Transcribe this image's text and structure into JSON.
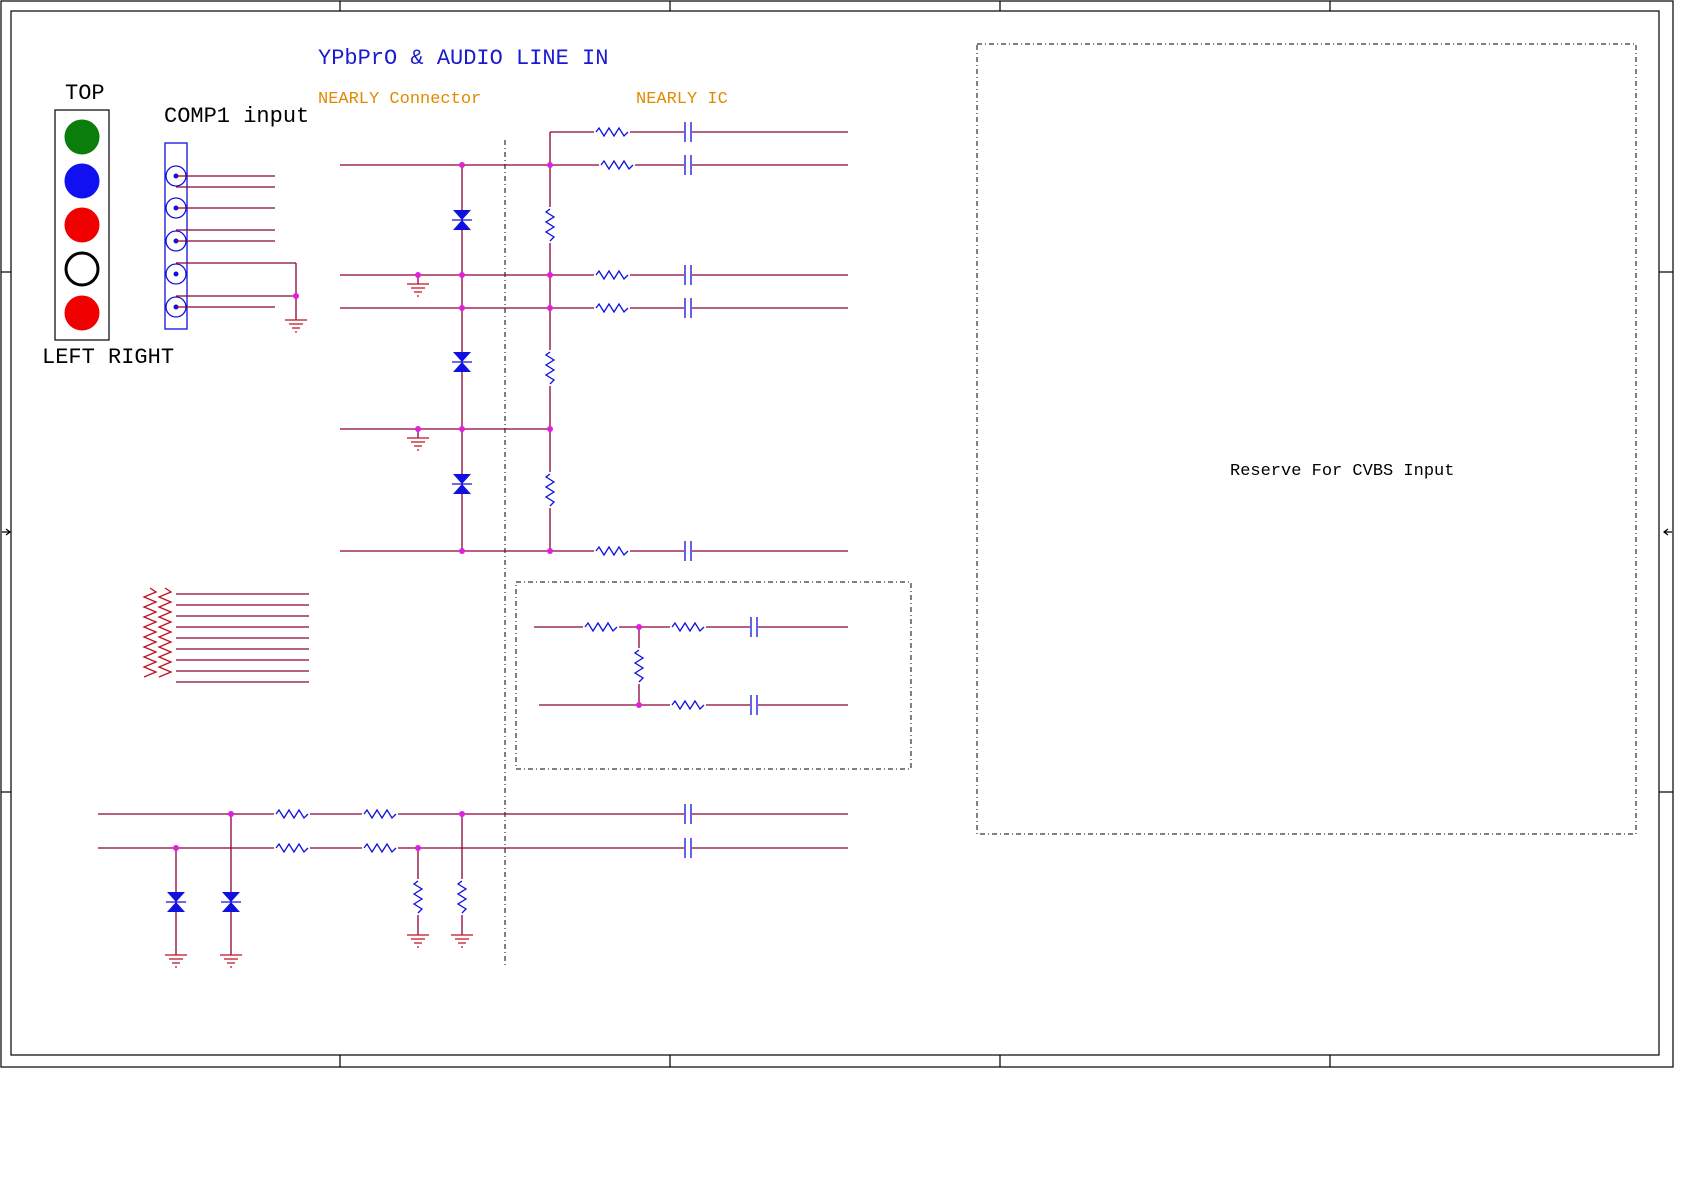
{
  "title": "YPbPrO & AUDIO LINE IN",
  "labels": {
    "connector": "NEARLY Connector",
    "ic": "NEARLY IC",
    "top": "TOP",
    "comp1": "COMP1 input",
    "left_right": "LEFT RIGHT",
    "reserve": "Reserve For CVBS Input"
  },
  "jack_colors": [
    "#0a7d0a",
    "#1010f0",
    "#f00000",
    "#ffffff",
    "#f00000"
  ]
}
